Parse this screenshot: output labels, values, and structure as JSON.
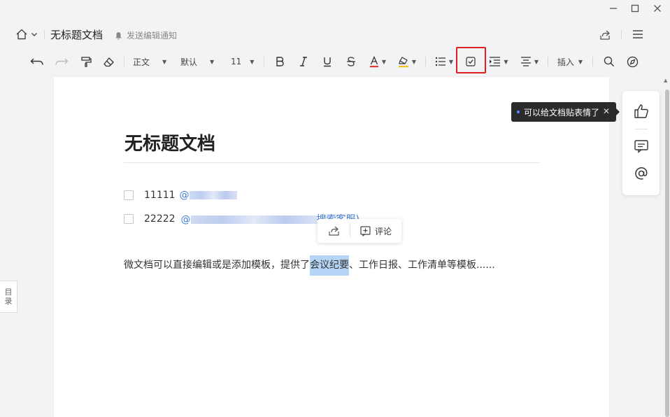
{
  "window": {
    "minimize_icon": "minimize-icon",
    "maximize_icon": "maximize-icon",
    "close_icon": "close-icon"
  },
  "header": {
    "doc_title": "无标题文档",
    "notify_label": "发送编辑通知",
    "home_icon": "home-icon",
    "share_icon": "share-icon",
    "menu_icon": "menu-icon"
  },
  "toolbar": {
    "paragraph_style": "正文",
    "font_family": "默认",
    "font_size": "11",
    "insert_label": "插入"
  },
  "document": {
    "title": "无标题文档",
    "tasks": [
      {
        "text": "11111",
        "mention": "@"
      },
      {
        "text": "22222",
        "mention": "@"
      }
    ],
    "mention_suffix_2": "搜索客服)",
    "paragraph": {
      "before": "微文档可以直接编辑或是添加模板，提供了",
      "selected": "会议纪要",
      "after": "、工作日报、工作清单等模板......"
    }
  },
  "popup": {
    "comment_label": "评论"
  },
  "tooltip": {
    "text": "可以给文档贴表情了"
  },
  "outline": {
    "line1": "目",
    "line2": "录"
  },
  "colors": {
    "accent": "#3d7bd6",
    "highlight_border": "#e02020",
    "selection": "#b4d5f5",
    "tooltip_bg": "#2b2b2b"
  }
}
